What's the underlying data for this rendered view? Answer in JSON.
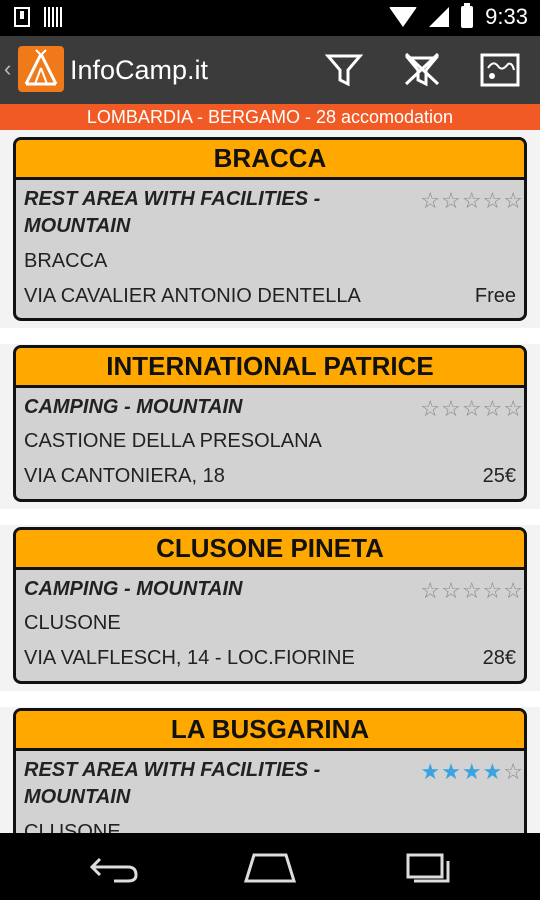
{
  "status_bar": {
    "time": "9:33"
  },
  "app": {
    "title": "InfoCamp.it"
  },
  "region": {
    "label": "LOMBARDIA - BERGAMO - 28 accomodation"
  },
  "colors": {
    "accent": "#ffa800",
    "banner": "#f15a24",
    "actionbar": "#3b3b3b",
    "star_on": "#3da3e0"
  },
  "listings": [
    {
      "name": "BRACCA",
      "type": "REST AREA WITH FACILITIES - MOUNTAIN",
      "stars": 0,
      "city": "BRACCA",
      "address": "VIA CAVALIER ANTONIO DENTELLA",
      "price": "Free"
    },
    {
      "name": "INTERNATIONAL PATRICE",
      "type": "CAMPING - MOUNTAIN",
      "stars": 0,
      "city": "CASTIONE DELLA PRESOLANA",
      "address": "VIA CANTONIERA, 18",
      "price": "25€"
    },
    {
      "name": "CLUSONE PINETA",
      "type": "CAMPING - MOUNTAIN",
      "stars": 0,
      "city": "CLUSONE",
      "address": "VIA VALFLESCH, 14 - LOC.FIORINE",
      "price": "28€"
    },
    {
      "name": "LA BUSGARINA",
      "type": "REST AREA WITH FACILITIES - MOUNTAIN",
      "stars": 4,
      "city": "CLUSONE",
      "address": "",
      "price": ""
    }
  ]
}
